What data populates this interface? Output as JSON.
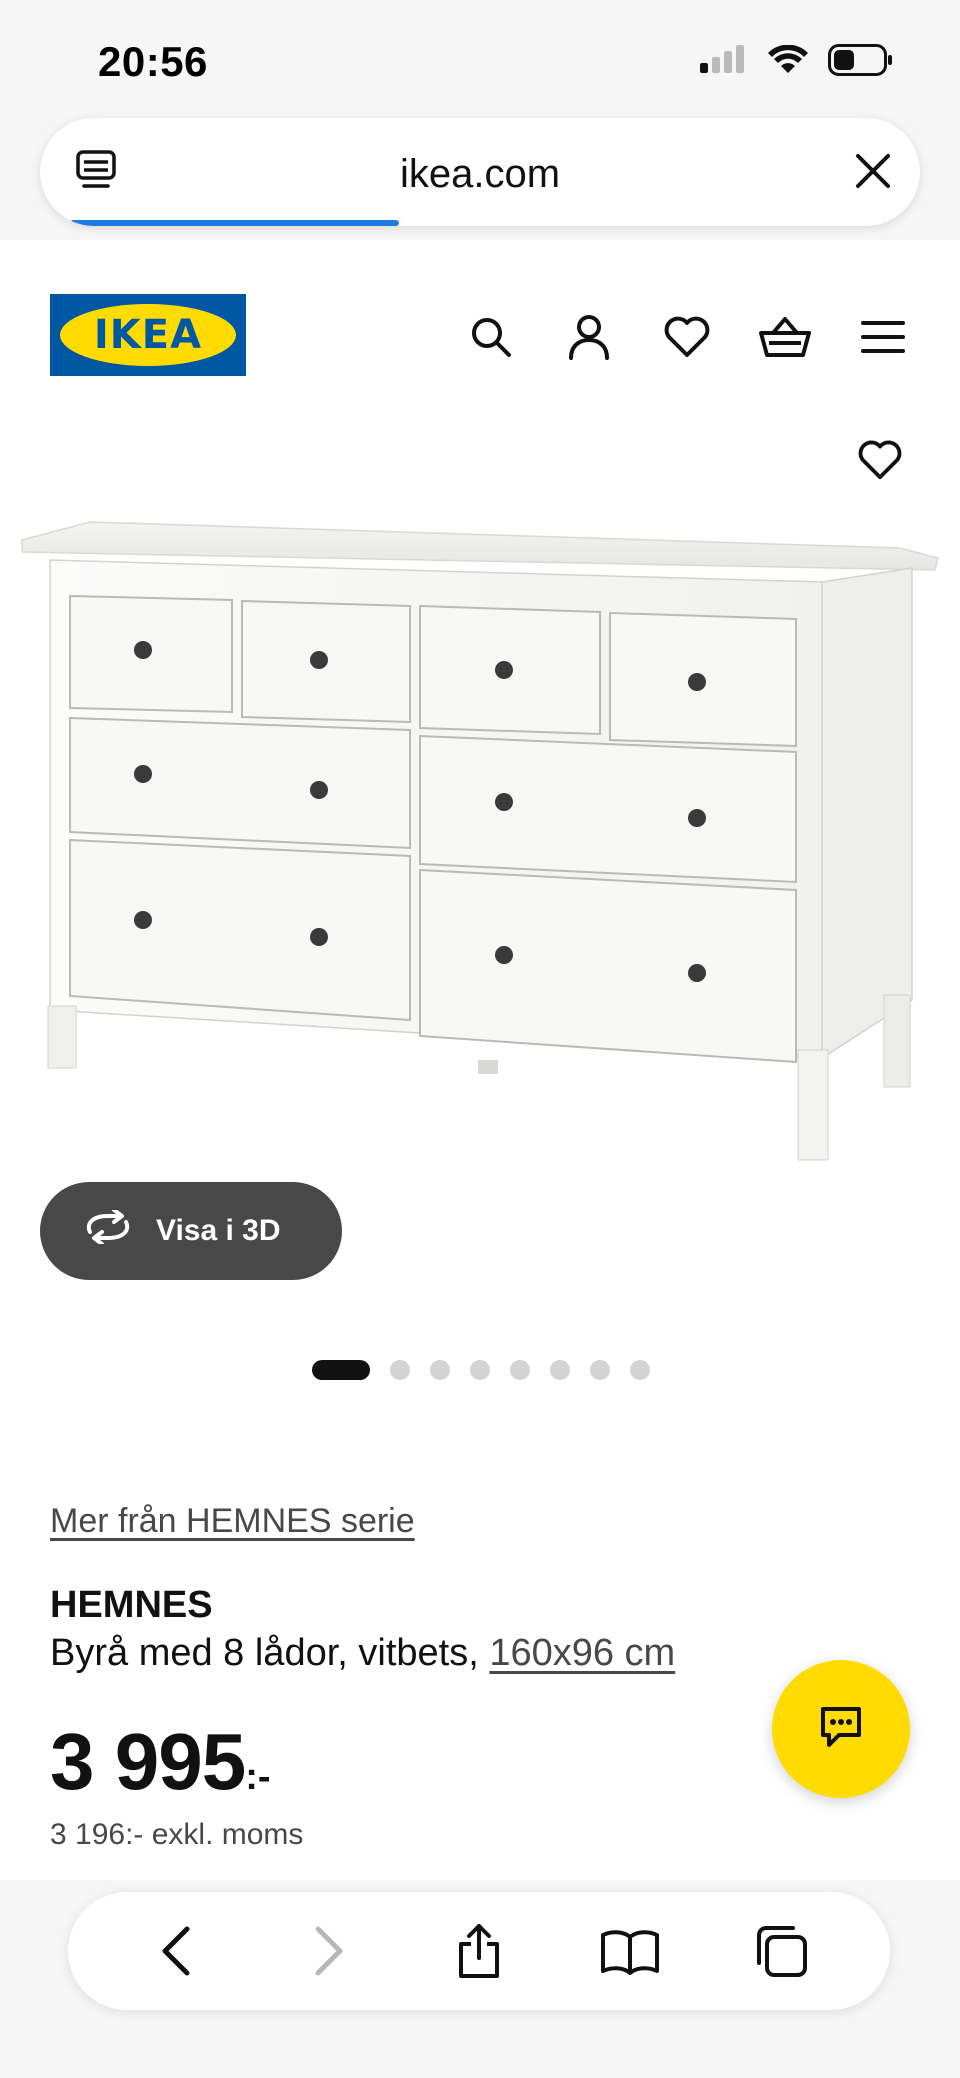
{
  "status_bar": {
    "time": "20:56"
  },
  "browser": {
    "url": "ikea.com",
    "load_progress": 0.31
  },
  "site": {
    "logo_text": "IKEA",
    "brand_colors": {
      "blue": "#0058a3",
      "yellow": "#ffdb00"
    },
    "header_icons": [
      "search-icon",
      "account-icon",
      "heart-icon",
      "cart-icon",
      "menu-icon"
    ]
  },
  "gallery": {
    "view_3d_label": "Visa i 3D",
    "image_count": 8,
    "active_index": 0
  },
  "product": {
    "series_link": "Mer från HEMNES serie",
    "name": "HEMNES",
    "description": "Byrå med 8 lådor, vitbets, ",
    "size_link": "160x96 cm",
    "price": "3 995",
    "price_suffix": ":-",
    "price_excl_vat": "3 196:- exkl. moms"
  },
  "toolbar_icons": [
    "back-icon",
    "forward-icon",
    "share-icon",
    "bookmarks-icon",
    "tabs-icon"
  ]
}
